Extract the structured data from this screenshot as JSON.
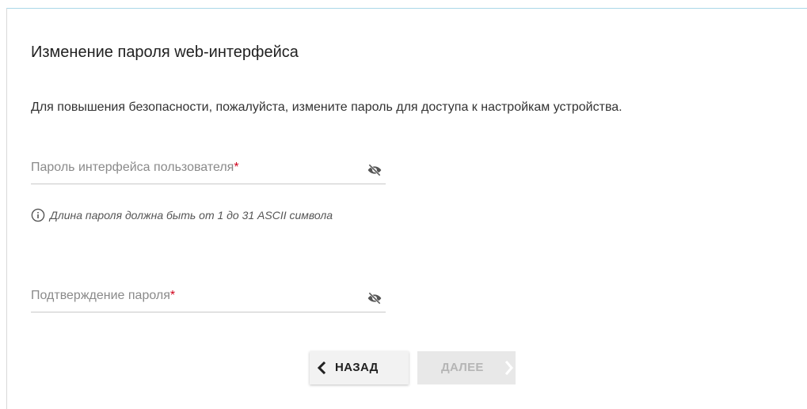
{
  "page": {
    "title": "Изменение пароля web-интерфейса",
    "description": "Для повышения безопасности, пожалуйста, измените пароль для доступа к настройкам устройства."
  },
  "password_field": {
    "label": "Пароль интерфейса пользователя",
    "required_mark": "*",
    "value": "",
    "icon": "eye-off-icon"
  },
  "hint": {
    "text": "Длина пароля должна быть от 1 до 31 ASCII символа",
    "icon": "info-icon"
  },
  "confirm_field": {
    "label": "Подтверждение пароля",
    "required_mark": "*",
    "value": "",
    "icon": "eye-off-icon"
  },
  "buttons": {
    "back_label": "НАЗАД",
    "next_label": "ДАЛЕЕ"
  },
  "colors": {
    "required": "#d0021b",
    "disabled_text": "#b5b5b5",
    "card_top_border": "#aad7e8"
  }
}
